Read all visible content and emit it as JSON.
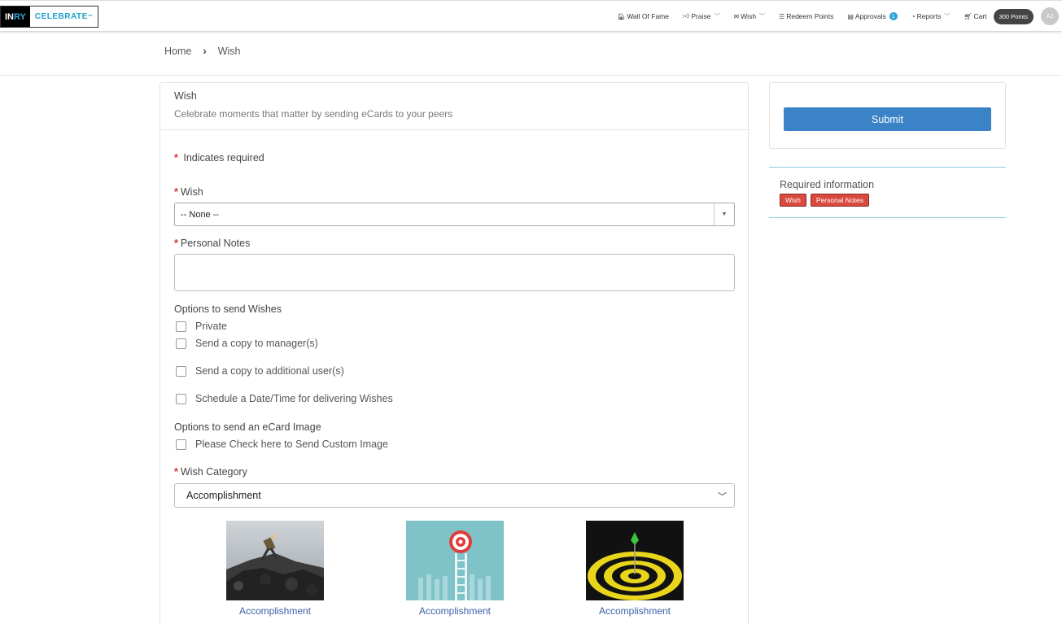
{
  "logo": {
    "part1": "IN",
    "part2": "RY",
    "part3": "CELEBRATE",
    "tm": "™"
  },
  "nav": {
    "items": [
      {
        "label": "Wall Of Fame",
        "icon": "home-icon",
        "glyph": "🏠︎"
      },
      {
        "label": "Praise",
        "icon": "thumbs-up-icon",
        "glyph": "👍︎"
      },
      {
        "label": "Wish",
        "icon": "envelope-icon",
        "glyph": "✉"
      },
      {
        "label": "Redeem Points",
        "icon": "list-icon",
        "glyph": "☰"
      },
      {
        "label": "Approvals",
        "icon": "calendar-icon",
        "glyph": "▤",
        "count": "1"
      },
      {
        "label": "Reports",
        "icon": "dashboard-icon",
        "glyph": "◔"
      },
      {
        "label": "Cart",
        "icon": "cart-icon",
        "glyph": "🛒︎"
      }
    ],
    "points": "300 Points",
    "avatar_initials": "AJ"
  },
  "breadcrumb": {
    "home": "Home",
    "sep": "›",
    "current": "Wish"
  },
  "form": {
    "title": "Wish",
    "subtitle": "Celebrate moments that matter by sending eCards to your peers",
    "required_note": "Indicates required",
    "required_star": "*",
    "wish_label": "Wish",
    "wish_value": "-- None --",
    "personal_notes_label": "Personal Notes",
    "personal_notes_value": "",
    "options_wishes_title": "Options to send Wishes",
    "options": [
      "Private",
      "Send a copy to manager(s)",
      "Send a copy to additional user(s)",
      "Schedule a Date/Time for delivering Wishes"
    ],
    "options_ecard_title": "Options to send an eCard Image",
    "custom_image_option": "Please Check here to Send Custom Image",
    "category_label": "Wish Category",
    "category_value": "Accomplishment",
    "tiles": [
      "Accomplishment",
      "Accomplishment",
      "Accomplishment"
    ]
  },
  "sidebar": {
    "submit_label": "Submit",
    "required_info_title": "Required information",
    "required_tags": [
      "Wish",
      "Personal Notes"
    ]
  },
  "colors": {
    "accent": "#3b83c7",
    "required": "#d9493f",
    "link": "#3b5fa8",
    "brand": "#1aa3c8"
  }
}
